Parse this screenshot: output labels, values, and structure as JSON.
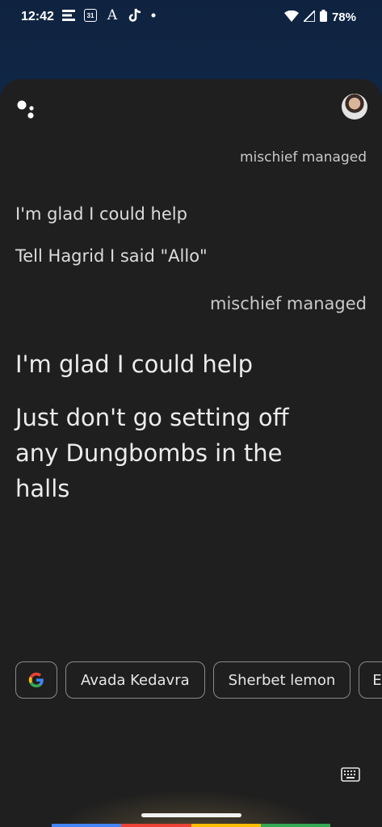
{
  "status_bar": {
    "time": "12:42",
    "battery": "78%",
    "left_icons": [
      "news-icon",
      "calendar-icon",
      "font-icon",
      "tiktok-icon",
      "dot-icon"
    ],
    "calendar_day": "31"
  },
  "conversation": [
    {
      "role": "user",
      "text": "mischief managed"
    },
    {
      "role": "assistant",
      "text": "I'm glad I could help"
    },
    {
      "role": "assistant",
      "text": "Tell Hagrid I said \"Allo\""
    },
    {
      "role": "user",
      "text": "mischief managed"
    },
    {
      "role": "assistant",
      "text": "I'm glad I could help"
    },
    {
      "role": "assistant",
      "text": "Just don't go setting off any Dungbombs in the halls"
    }
  ],
  "suggestions": [
    "Avada Kedavra",
    "Sherbet lemon",
    "Ele"
  ],
  "colors": {
    "sheet_bg": "#1f1f1f",
    "google_blue": "#4285F4",
    "google_red": "#EA4335",
    "google_yellow": "#FBBC05",
    "google_green": "#34A853"
  }
}
